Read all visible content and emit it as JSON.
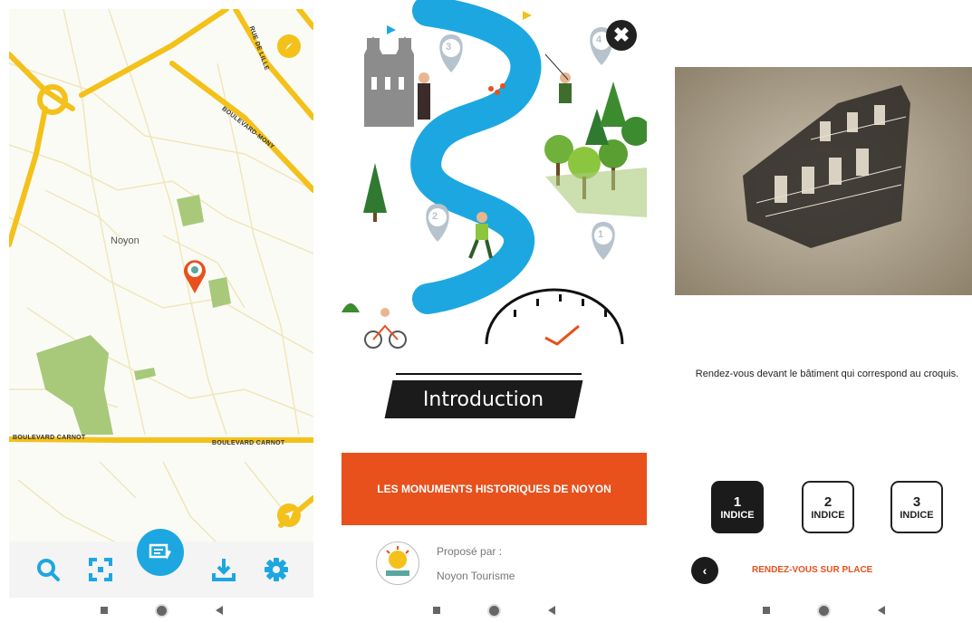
{
  "map_screen": {
    "city_label": "Noyon",
    "streets": {
      "rue_de_lille": "RUE DE LILLE",
      "boulevard_mony": "BOULEVARD-MONY",
      "boulevard_carnot_left": "BOULEVARD CARNOT",
      "boulevard_carnot_right": "BOULEVARD CARNOT"
    },
    "nav_icons": [
      "search-icon",
      "scan-icon",
      "map-book-icon",
      "download-icon",
      "settings-icon"
    ],
    "colors": {
      "road": "#f3c11a",
      "accent": "#1da7e1",
      "pin": "#e8501c",
      "park": "#a8c97a"
    }
  },
  "intro_screen": {
    "close_symbol": "✖",
    "title": "Introduction",
    "tour_title": "LES MONUMENTS HISTORIQUES DE NOYON",
    "proposed_by_label": "Proposé par :",
    "proposed_by_name": "Noyon Tourisme",
    "waypoints": [
      "3",
      "4",
      "2",
      "1"
    ],
    "colors": {
      "river": "#1da7e1",
      "banner": "#e8501c"
    }
  },
  "clue_screen": {
    "instruction": "Rendez-vous devant le bâtiment qui correspond au croquis.",
    "hints": [
      {
        "number": "1",
        "label": "INDICE",
        "active": true
      },
      {
        "number": "2",
        "label": "INDICE",
        "active": false
      },
      {
        "number": "3",
        "label": "INDICE",
        "active": false
      }
    ],
    "back_symbol": "‹",
    "go_label": "RENDEZ-VOUS SUR PLACE"
  }
}
